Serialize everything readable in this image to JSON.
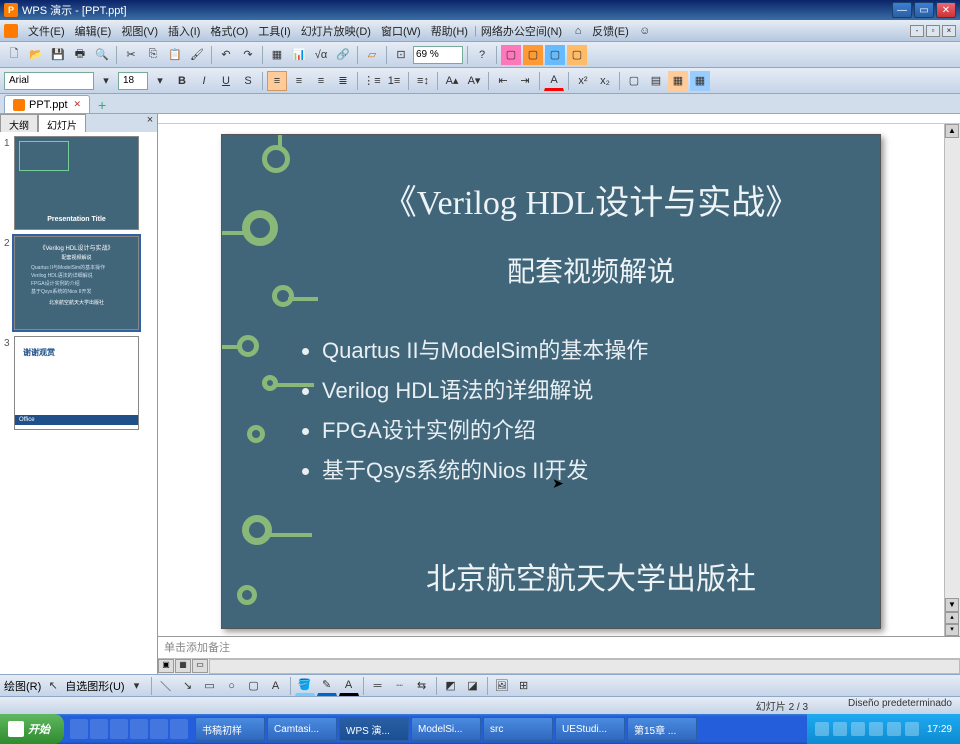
{
  "window": {
    "title": "WPS 演示 - [PPT.ppt]"
  },
  "menu": {
    "file": "文件(E)",
    "edit": "编辑(E)",
    "view": "视图(V)",
    "insert": "插入(I)",
    "format": "格式(O)",
    "tools": "工具(I)",
    "slideshow": "幻灯片放映(D)",
    "window": "窗口(W)",
    "help": "帮助(H)",
    "netspace": "网络办公空间(N)",
    "feedback": "反馈(E)"
  },
  "toolbar": {
    "zoom": "69 %"
  },
  "format": {
    "font": "Arial",
    "size": "18"
  },
  "doctab": {
    "name": "PPT.ppt"
  },
  "sidepanel": {
    "tab_outline": "大纲",
    "tab_slides": "幻灯片"
  },
  "thumbs": {
    "t1_label": "Presentation Title",
    "t2_title": "《Verilog HDL设计与实战》",
    "t2_sub": "配套视频解说",
    "t2_b1": "Quartus II与ModelSim的基本操作",
    "t2_b2": "Verilog HDL语法的详细解说",
    "t2_b3": "FPGA设计实例的介绍",
    "t2_b4": "基于Qsys系统的Nios II开发",
    "t2_pub": "北京航空航天大学出版社",
    "t3_title": "谢谢观赏",
    "t3_ofc": "Office"
  },
  "slide": {
    "title": "《Verilog HDL设计与实战》",
    "subtitle": "配套视频解说",
    "b1": "Quartus II与ModelSim的基本操作",
    "b2": "Verilog HDL语法的详细解说",
    "b3": "FPGA设计实例的介绍",
    "b4": "基于Qsys系统的Nios II开发",
    "publisher": "北京航空航天大学出版社"
  },
  "notes": {
    "placeholder": "单击添加备注"
  },
  "drawbar": {
    "draw": "绘图(R)",
    "autoshape": "自选图形(U)"
  },
  "status": {
    "slide": "幻灯片 2 / 3",
    "design": "Diseño predeterminado"
  },
  "taskbar": {
    "start": "开始",
    "t1": "书稿初样",
    "t2": "Camtasi...",
    "t3": "WPS 演...",
    "t4": "ModelSi...",
    "t5": "src",
    "t6": "UEStudi...",
    "t7": "第15章 ...",
    "clock": "17:29"
  }
}
